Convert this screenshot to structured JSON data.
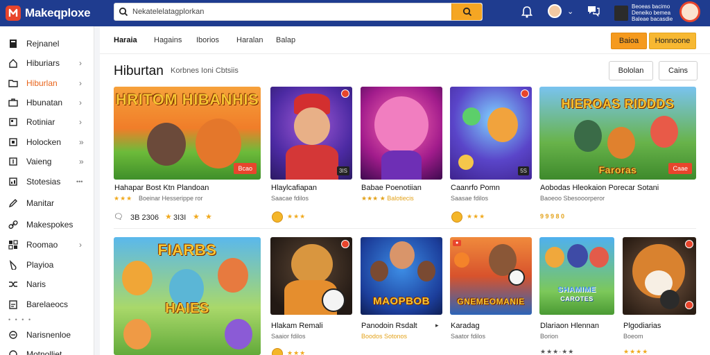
{
  "app": {
    "name": "Makeqploxe"
  },
  "search": {
    "query": "Nekatelelatagplorkan"
  },
  "account": {
    "line1": "Beoeas bacimo",
    "line2": "Deneiko bemea",
    "line3": "Baleae bacasdie"
  },
  "sidebar": {
    "items": [
      {
        "label": "Rejnanel",
        "icon": "book-icon"
      },
      {
        "label": "Hiburiars",
        "icon": "home-icon",
        "arrow": "›"
      },
      {
        "label": "Hiburlan",
        "icon": "folder-icon",
        "arrow": "›",
        "active": true
      },
      {
        "label": "Hbunatan",
        "icon": "briefcase-icon",
        "arrow": "›"
      },
      {
        "label": "Rotiniar",
        "icon": "card-icon",
        "arrow": "›"
      },
      {
        "label": "Holocken",
        "icon": "box-icon",
        "arrow": "»"
      },
      {
        "label": "Vaieng",
        "icon": "tag-icon",
        "arrow": "»"
      },
      {
        "label": "Stotesias",
        "icon": "chart-icon",
        "arrow": "•••"
      },
      {
        "label": "Manitar",
        "icon": "pen-icon"
      },
      {
        "label": "Makespokes",
        "icon": "link-icon"
      },
      {
        "label": "Roomao",
        "icon": "grid-icon",
        "arrow": "›"
      },
      {
        "label": "Playioa",
        "icon": "drop-icon"
      },
      {
        "label": "Naris",
        "icon": "shuffle-icon"
      },
      {
        "label": "Barelaeocs",
        "icon": "clipboard-icon"
      },
      {
        "label": "Narisnenloe",
        "icon": "circle-icon"
      },
      {
        "label": "Motnolliet",
        "icon": "circle-outline-icon"
      }
    ],
    "dots": "• • • •"
  },
  "tabs": [
    "Haraia",
    "Hagains",
    "Iborios",
    "Haralan",
    "Balap"
  ],
  "tab_buttons": {
    "primary": "Baioa",
    "secondary": "Honnoone"
  },
  "section": {
    "title": "Hiburtan",
    "subtitle": "Korbnes Ioni Cbtsiis",
    "btn_left": "Bololan",
    "btn_right": "Cains"
  },
  "cards_row1": [
    {
      "title": "Hahapar Bost Ktn Plandoan",
      "meta": "Boeinar    Hesserippe ror",
      "stars": "★★★",
      "banner": "HRITOM HIBANHIS",
      "badge": "Bcao"
    },
    {
      "title": "Hlaylcafiapan",
      "meta": "Saacae fdilos",
      "badge": "3IS"
    },
    {
      "title": "Babae Poenotiian",
      "meta": "★★★ ★    Balotiecis",
      "badge": ""
    },
    {
      "title": "Caanrfo Pomn",
      "meta": "Saasae fdilos",
      "badge": "5S"
    },
    {
      "title": "Aobodas Hleokaion Porecar Sotani",
      "meta": "Baoeoo    Sbesooorperor",
      "banner": "HIEROAS RIDDDS",
      "banner2": "Faroras",
      "badge": "Caae"
    }
  ],
  "card1_extra": {
    "likes": "3B 2306",
    "rating": "3I3I"
  },
  "card5_extra": {
    "rating": "9 9 9 8 0"
  },
  "cards_row2": [
    {
      "title": "",
      "meta": "",
      "banner": "FIARBS",
      "banner2": "HAIES"
    },
    {
      "title": "Hlakam Remali",
      "meta": "Saaior fdilos"
    },
    {
      "title": "Panodoin Rsdalt",
      "meta": "Boodos Sotonos",
      "arrow": "▸",
      "banner": "MAOPBOB"
    },
    {
      "title": "Karadag",
      "meta": "Saator fdilos",
      "banner": "GNEMEOMANIE"
    },
    {
      "title": "Dlariaon Hlennan",
      "meta": "Borion",
      "banner": "SHAMIME",
      "banner2": "CAROTES"
    },
    {
      "title": "Plgodiarias",
      "meta": "Boeom"
    }
  ],
  "card6_stars": "★★★★"
}
